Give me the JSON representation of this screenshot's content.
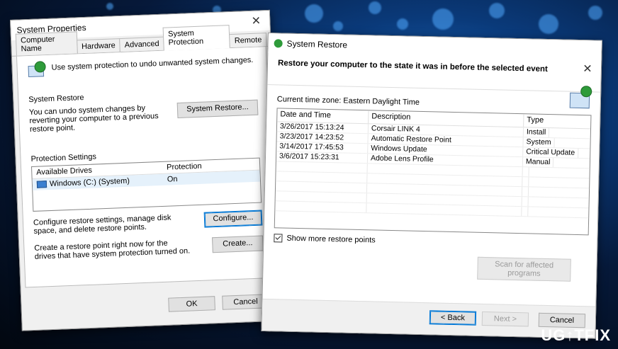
{
  "system_properties": {
    "title": "System Properties",
    "tabs": [
      "Computer Name",
      "Hardware",
      "Advanced",
      "System Protection",
      "Remote"
    ],
    "active_tab": "System Protection",
    "intro": "Use system protection to undo unwanted system changes.",
    "restore_group": "System Restore",
    "restore_text": "You can undo system changes by reverting your computer to a previous restore point.",
    "restore_button": "System Restore...",
    "protection_group": "Protection Settings",
    "col_drives": "Available Drives",
    "col_protection": "Protection",
    "drive_name": "Windows (C:) (System)",
    "drive_status": "On",
    "configure_text": "Configure restore settings, manage disk space, and delete restore points.",
    "configure_button": "Configure...",
    "create_text": "Create a restore point right now for the drives that have system protection turned on.",
    "create_button": "Create...",
    "ok_button": "OK",
    "cancel_button": "Cancel"
  },
  "system_restore": {
    "title": "System Restore",
    "heading": "Restore your computer to the state it was in before the selected event",
    "timezone": "Current time zone: Eastern Daylight Time",
    "columns": [
      "Date and Time",
      "Description",
      "Type"
    ],
    "rows": [
      {
        "date": "3/26/2017 15:13:24",
        "description": "Corsair LINK 4",
        "type": "Install"
      },
      {
        "date": "3/23/2017 14:23:52",
        "description": "Automatic Restore Point",
        "type": "System"
      },
      {
        "date": "3/14/2017 17:45:53",
        "description": "Windows Update",
        "type": "Critical Update"
      },
      {
        "date": "3/6/2017 15:23:31",
        "description": "Adobe Lens Profile",
        "type": "Manual"
      }
    ],
    "show_more": "Show more restore points",
    "scan_button": "Scan for affected programs",
    "back_button": "< Back",
    "next_button": "Next >",
    "cancel_button": "Cancel"
  },
  "watermark": "UG↑TFIX"
}
